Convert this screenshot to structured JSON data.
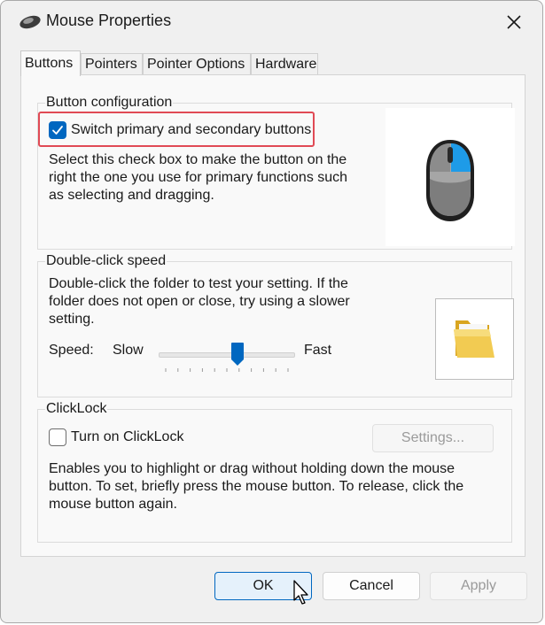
{
  "window": {
    "title": "Mouse Properties",
    "close_icon": "close-icon",
    "app_icon": "mouse-icon"
  },
  "tabs": [
    {
      "label": "Buttons",
      "active": true
    },
    {
      "label": "Pointers",
      "active": false
    },
    {
      "label": "Pointer Options",
      "active": false
    },
    {
      "label": "Hardware",
      "active": false
    }
  ],
  "button_configuration": {
    "group_label": "Button configuration",
    "checkbox_label": "Switch primary and secondary buttons",
    "checked": true,
    "description_lines": [
      "Select this check box to make the button on the",
      "right the one you use for primary functions such",
      "as selecting and dragging."
    ],
    "highlight_color": "#e04a55"
  },
  "double_click": {
    "group_label": "Double-click speed",
    "description_lines": [
      "Double-click the folder to test your setting. If the",
      "folder does not open or close, try using a slower",
      "setting."
    ],
    "speed_label": "Speed:",
    "slow_label": "Slow",
    "fast_label": "Fast",
    "speed_value": 0.58,
    "tick_count": 11
  },
  "clicklock": {
    "group_label": "ClickLock",
    "checkbox_label": "Turn on ClickLock",
    "checked": false,
    "settings_label": "Settings...",
    "description_lines": [
      "Enables you to highlight or drag without holding down the mouse",
      "button. To set, briefly press the mouse button. To release, click the",
      "mouse button again."
    ]
  },
  "footer": {
    "ok_label": "OK",
    "cancel_label": "Cancel",
    "apply_label": "Apply"
  },
  "colors": {
    "accent": "#0067c0",
    "mouse_highlight": "#1e9be8"
  }
}
